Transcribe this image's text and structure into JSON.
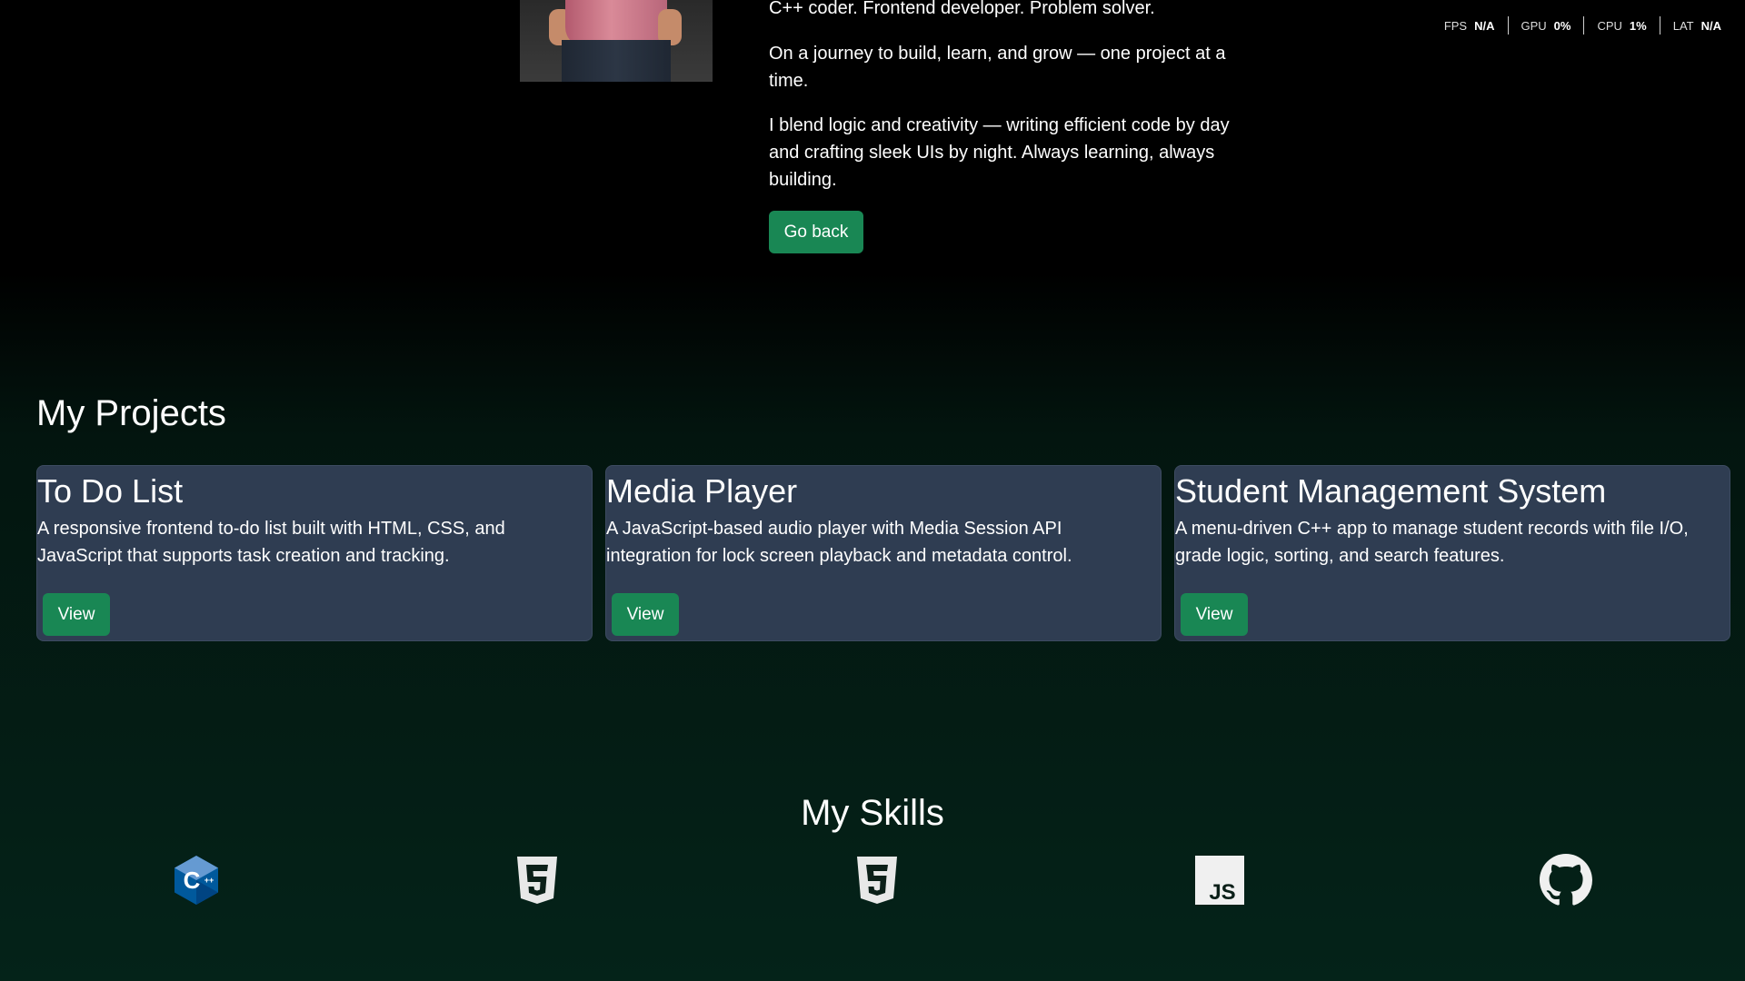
{
  "about": {
    "line1": "C++ coder. Frontend developer. Problem solver.",
    "line2": "On a journey to build, learn, and grow — one project at a time.",
    "line3": "I blend logic and creativity — writing efficient code by day and crafting sleek UIs by night. Always learning, always building.",
    "go_back_label": "Go back"
  },
  "perf": {
    "fps_label": "FPS",
    "fps_value": "N/A",
    "gpu_label": "GPU",
    "gpu_value": "0%",
    "cpu_label": "CPU",
    "cpu_value": "1%",
    "lat_label": "LAT",
    "lat_value": "N/A"
  },
  "projects": {
    "title": "My Projects",
    "items": [
      {
        "title": "To Do List",
        "description": "A responsive frontend to-do list built with HTML, CSS, and JavaScript that supports task creation and tracking.",
        "button": "View"
      },
      {
        "title": "Media Player",
        "description": "A JavaScript-based audio player with Media Session API integration for lock screen playback and metadata control.",
        "button": "View"
      },
      {
        "title": "Student Management System",
        "description": "A menu-driven C++ app to manage student records with file I/O, grade logic, sorting, and search features.",
        "button": "View"
      }
    ]
  },
  "skills": {
    "title": "My Skills",
    "icons": [
      "cpp-icon",
      "html5-icon",
      "css3-icon",
      "javascript-icon",
      "github-icon"
    ],
    "cpp_text": "C",
    "cpp_plus": "++",
    "js_text": "JS"
  },
  "colors": {
    "accent_button": "#198754",
    "card_background": "#2f3d52",
    "page_background_bottom": "#042319"
  }
}
